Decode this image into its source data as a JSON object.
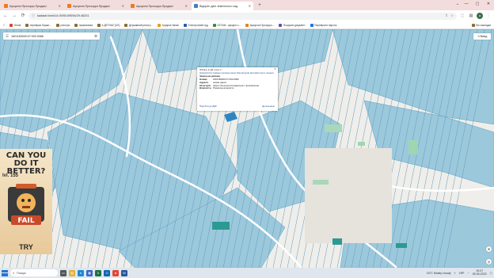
{
  "tabs": [
    {
      "title": "Аукціони Прозорро.Продажі",
      "color": "#e67e22",
      "active": false
    },
    {
      "title": "Аукціони Прозорро.Продажі",
      "color": "#e67e22",
      "active": false
    },
    {
      "title": "Аукціони Прозорро.Продажі",
      "color": "#e67e22",
      "active": false
    },
    {
      "title": "Відкриті дані земельного кад",
      "color": "#3f7fbf",
      "active": true
    }
  ],
  "new_tab": "+",
  "window_controls": {
    "dropdown": "⌄",
    "minimize": "—",
    "maximize": "▢",
    "close": "✕"
  },
  "toolbar": {
    "back": "←",
    "forward": "→",
    "reload": "⟳",
    "url": "kadastr.live/#14.09/50.69594/29.46201",
    "share": "⇪",
    "star": "☆",
    "extensions": "⬚",
    "sidepanel": "▤",
    "profile": "a",
    "menu": "⋮"
  },
  "bookmarks": [
    {
      "label": "Gmail",
      "color": "#d44638"
    },
    {
      "label": "перевірка боржн...",
      "color": "#8a6d3b"
    },
    {
      "label": "реєстри",
      "color": "#8a6d3b"
    },
    {
      "label": "нормативка",
      "color": "#8a6d3b"
    },
    {
      "label": "К ДЕТНАС'(2/2)",
      "color": "#8a6d3b"
    },
    {
      "label": "Державний реєстр...",
      "color": "#8a6d3b"
    },
    {
      "label": "Аграрне банкіг",
      "color": "#e0a020"
    },
    {
      "label": "Електронний суд",
      "color": "#1f5fa8"
    },
    {
      "label": "СЕТАМ - аукціон с...",
      "color": "#3a8a3a"
    },
    {
      "label": "Аукціони Прозорро...",
      "color": "#e67e22"
    },
    {
      "label": "Пошуков документ",
      "color": "#6b4ea0"
    },
    {
      "label": "Перевірити пароль",
      "color": "#1a73e8"
    }
  ],
  "bookmarks_right": "Всі закладки",
  "map": {
    "search_value": "1821183000:07:002:0066",
    "exit_label": "Вихід",
    "popup": {
      "title": "Обгніть в цій точці: 1",
      "link1": "Написатися правою кнопкою мишi 10м фігурції автоматичного зняння",
      "section": "Земельна ділянка",
      "fields": [
        {
          "k": "Номер:",
          "v": "1821183000:07:002:0066"
        },
        {
          "k": "Адреса:",
          "v": "немає даних"
        },
        {
          "k": "Категорія:",
          "v": "Землі сільськогосподарського призначення"
        },
        {
          "k": "Власність:",
          "v": "Приватна власність"
        }
      ],
      "link_left": "Перейти до ДЗК",
      "link_right": "Детальніше"
    },
    "zoom": "⊕",
    "locate": "◎"
  },
  "ad": {
    "headline": "CAN YOU DO IT BETTER?",
    "level": "lvl. 155",
    "fail": "FAIL",
    "cta": "TRY"
  },
  "taskbar": {
    "search_placeholder": "Пошук",
    "weather": "15°C  Mostly cloudy",
    "lang": "УКР",
    "time": "19:27",
    "date": "05.06.2023"
  }
}
